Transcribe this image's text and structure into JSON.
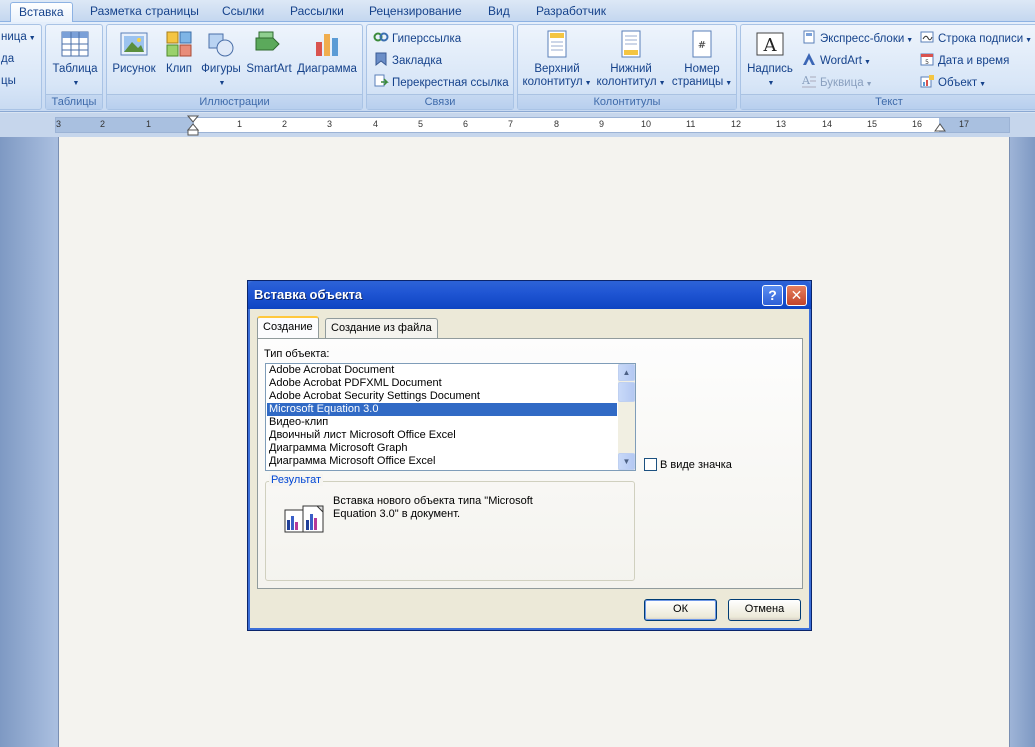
{
  "ribbon": {
    "tabs": [
      "Вставка",
      "Разметка страницы",
      "Ссылки",
      "Рассылки",
      "Рецензирование",
      "Вид",
      "Разработчик"
    ],
    "active_tab": "Вставка",
    "left_partial": [
      "ница",
      "да",
      "цы"
    ],
    "groups": {
      "tables": {
        "label": "Таблицы",
        "table": "Таблица"
      },
      "illustrations": {
        "label": "Иллюстрации",
        "picture": "Рисунок",
        "clip": "Клип",
        "shapes": "Фигуры",
        "smartart": "SmartArt",
        "chart": "Диаграмма"
      },
      "links": {
        "label": "Связи",
        "hyperlink": "Гиперссылка",
        "bookmark": "Закладка",
        "crossref": "Перекрестная ссылка"
      },
      "header_footer": {
        "label": "Колонтитулы",
        "header_l1": "Верхний",
        "header_l2": "колонтитул",
        "footer_l1": "Нижний",
        "footer_l2": "колонтитул",
        "pagenum_l1": "Номер",
        "pagenum_l2": "страницы"
      },
      "text": {
        "label": "Текст",
        "textbox": "Надпись",
        "quickparts": "Экспресс-блоки",
        "wordart": "WordArt",
        "dropcap": "Буквица",
        "signature": "Строка подписи",
        "datetime": "Дата и время",
        "object": "Объект"
      }
    }
  },
  "ruler": {
    "numbers": [
      "3",
      "2",
      "1",
      "1",
      "2",
      "3",
      "4",
      "5",
      "6",
      "7",
      "8",
      "9",
      "10",
      "11",
      "12",
      "13",
      "14",
      "15",
      "16",
      "17"
    ]
  },
  "dialog": {
    "title": "Вставка объекта",
    "help": "?",
    "close": "✕",
    "tabs": {
      "create": "Создание",
      "from_file": "Создание из файла"
    },
    "type_label": "Тип объекта:",
    "items": [
      "Adobe Acrobat Document",
      "Adobe Acrobat PDFXML Document",
      "Adobe Acrobat Security Settings Document",
      "Microsoft Equation 3.0",
      "Видео-клип",
      "Двоичный лист Microsoft Office Excel",
      "Диаграмма Microsoft Graph",
      "Диаграмма Microsoft Office Excel"
    ],
    "selected_item": "Microsoft Equation 3.0",
    "as_icon_label": "В виде значка",
    "as_icon_checked": false,
    "result_label": "Результат",
    "result_text": "Вставка нового объекта типа \"Microsoft Equation 3.0\" в документ.",
    "ok": "ОК",
    "cancel": "Отмена"
  }
}
